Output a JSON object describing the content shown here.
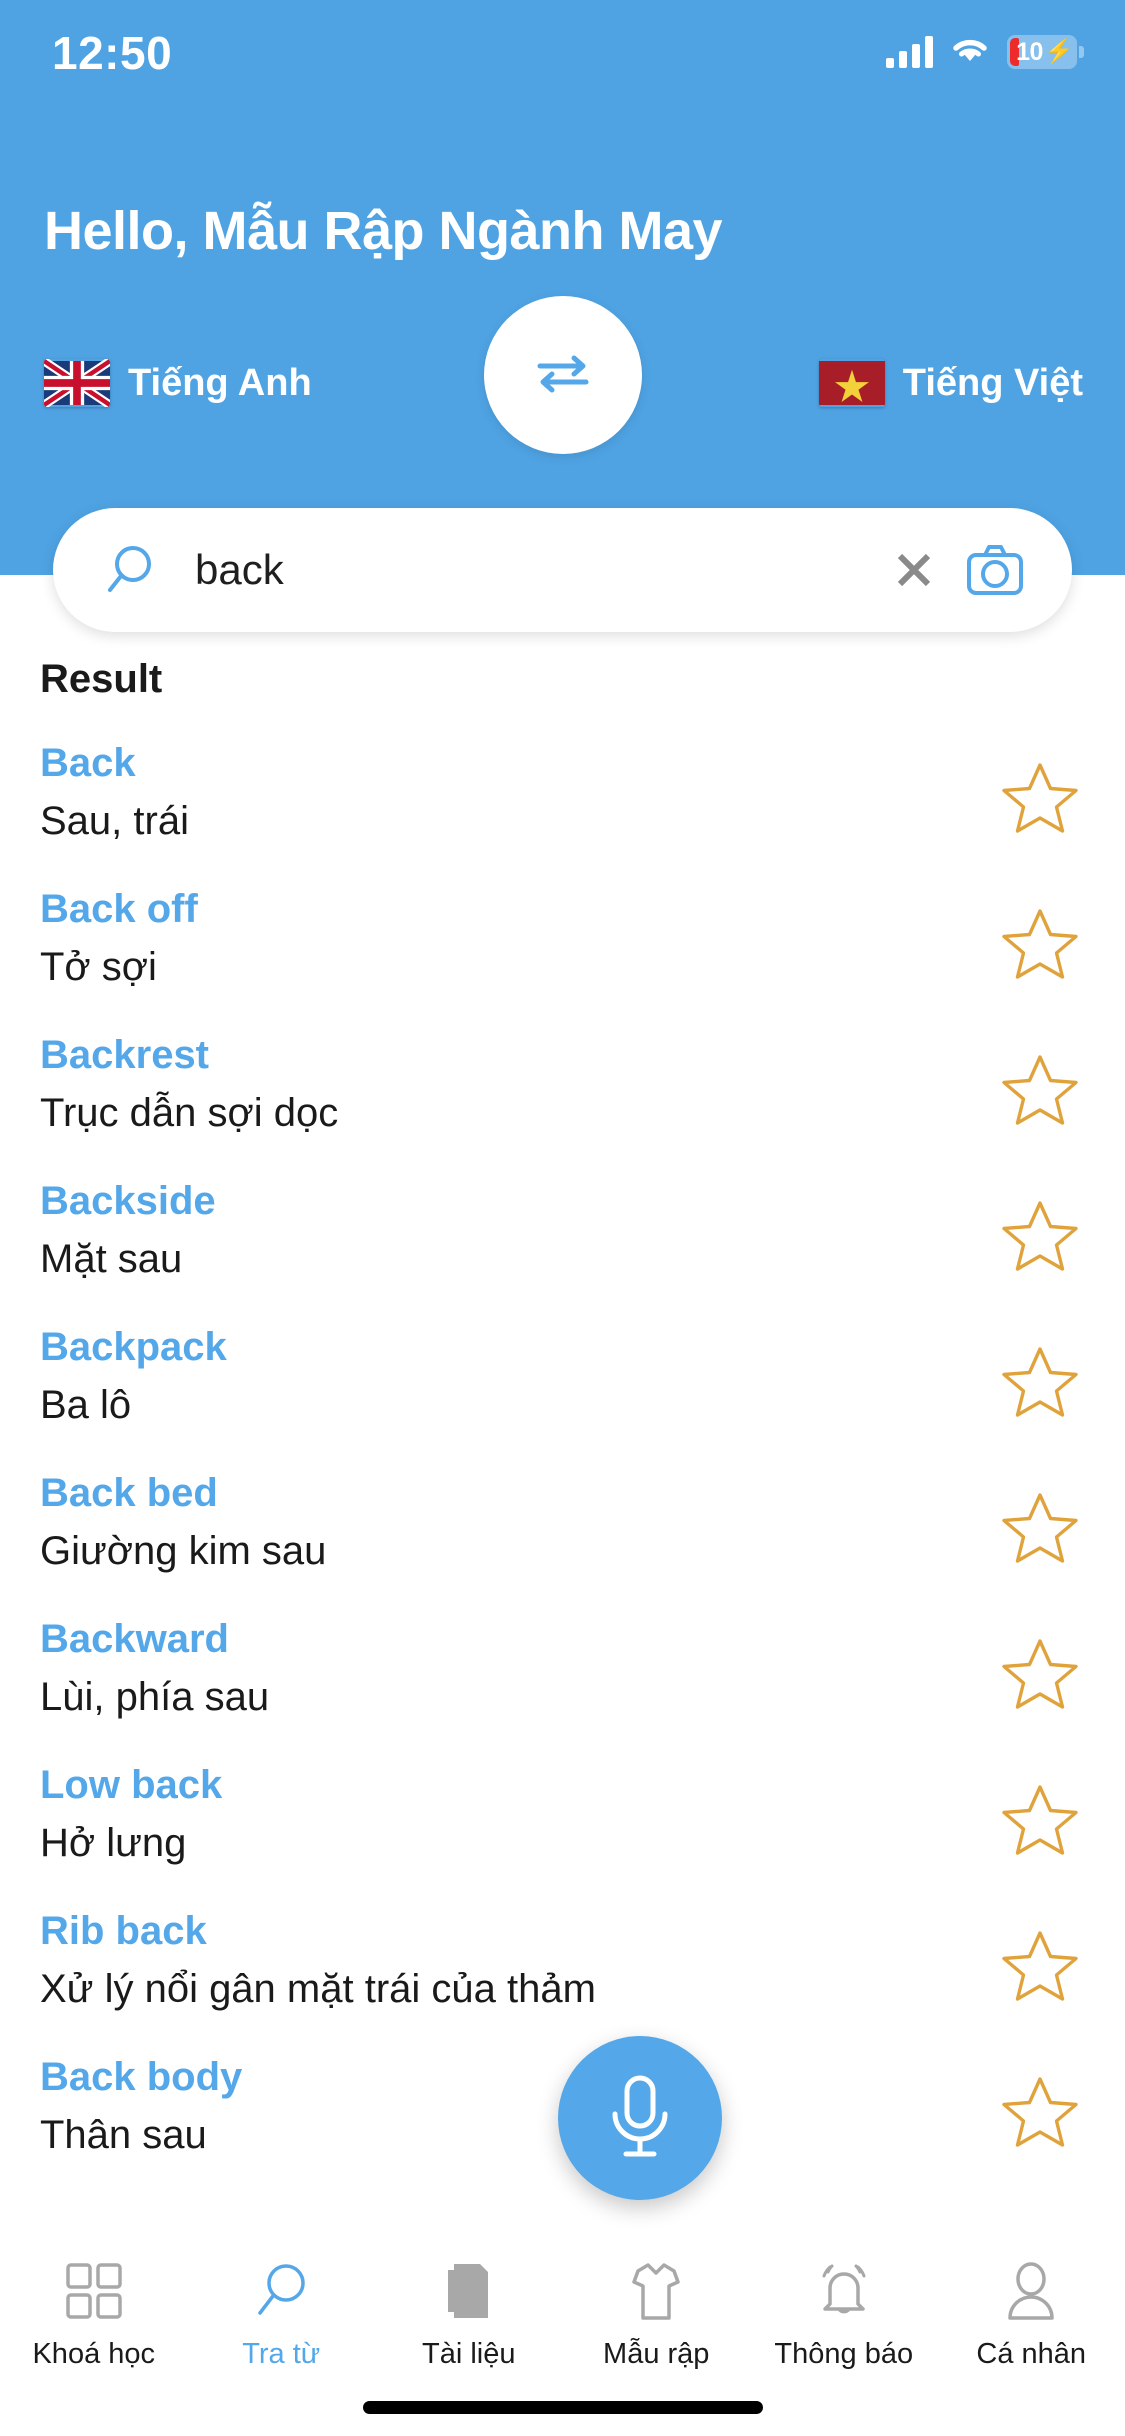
{
  "status_bar": {
    "time": "12:50",
    "signal_icon": "cellular-signal-icon",
    "wifi_icon": "wifi-icon",
    "battery_level": "10",
    "battery_icon": "battery-charging-icon"
  },
  "header": {
    "greeting": "Hello, Mẫu Rập Ngành May",
    "source_language": {
      "label": "Tiếng Anh",
      "flag": "uk-flag-icon"
    },
    "target_language": {
      "label": "Tiếng Việt",
      "flag": "vietnam-flag-icon"
    },
    "swap_icon": "swap-horizontal-icon"
  },
  "search": {
    "value": "back",
    "placeholder": "Tra từ",
    "search_icon": "magnifier-icon",
    "clear_icon": "close-x-icon",
    "camera_icon": "camera-icon"
  },
  "results": {
    "title": "Result",
    "star_icon": "star-outline-icon",
    "items": [
      {
        "term": "Back",
        "definition": "Sau, trái"
      },
      {
        "term": "Back off",
        "definition": "Tở sợi"
      },
      {
        "term": "Backrest",
        "definition": "Trục dẫn sợi dọc"
      },
      {
        "term": "Backside",
        "definition": "Mặt sau"
      },
      {
        "term": "Backpack",
        "definition": "Ba lô"
      },
      {
        "term": "Back bed",
        "definition": "Giường kim sau"
      },
      {
        "term": "Backward",
        "definition": "Lùi, phía sau"
      },
      {
        "term": "Low back",
        "definition": "Hở lưng"
      },
      {
        "term": "Rib back",
        "definition": "Xử lý nổi gân mặt trái của thảm"
      },
      {
        "term": "Back body",
        "definition": "Thân sau"
      }
    ]
  },
  "mic_button": {
    "icon": "microphone-icon"
  },
  "bottom_nav": {
    "items": [
      {
        "label": "Khoá học",
        "icon": "grid-icon",
        "active": false
      },
      {
        "label": "Tra từ",
        "icon": "magnifier-icon",
        "active": true
      },
      {
        "label": "Tài liệu",
        "icon": "document-icon",
        "active": false
      },
      {
        "label": "Mẫu rập",
        "icon": "tshirt-icon",
        "active": false
      },
      {
        "label": "Thông báo",
        "icon": "bell-icon",
        "active": false
      },
      {
        "label": "Cá nhân",
        "icon": "person-icon",
        "active": false
      }
    ]
  },
  "colors": {
    "brand_blue": "#4FA3E3",
    "accent_blue": "#54A7E8",
    "star_orange": "#E0A33C",
    "nav_grey": "#A8A8A8"
  }
}
